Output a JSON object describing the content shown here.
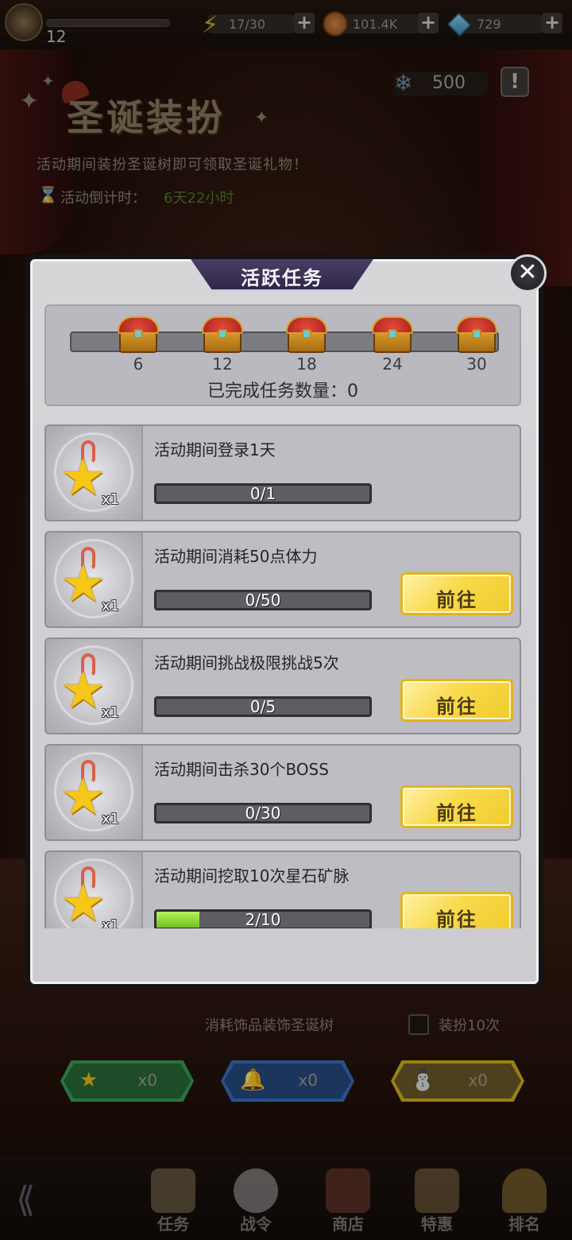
{
  "topbar": {
    "level": "12",
    "stamina": "17/30",
    "gold": "101.4K",
    "gems": "729"
  },
  "event": {
    "title": "圣诞装扮",
    "description": "活动期间装扮圣诞树即可领取圣诞礼物！",
    "countdown_label": "活动倒计时：",
    "countdown_value": "6天22小时",
    "snowflakes": "500"
  },
  "modal": {
    "title": "活跃任务",
    "milestones": [
      "6",
      "12",
      "18",
      "24",
      "30"
    ],
    "completed_label": "已完成任务数量：0",
    "go_label": "前往",
    "tasks": [
      {
        "title": "活动期间登录1天",
        "progress": "0/1",
        "reward": "x1",
        "fraction": 0,
        "has_button": false
      },
      {
        "title": "活动期间消耗50点体力",
        "progress": "0/50",
        "reward": "x1",
        "fraction": 0,
        "has_button": true
      },
      {
        "title": "活动期间挑战极限挑战5次",
        "progress": "0/5",
        "reward": "x1",
        "fraction": 0,
        "has_button": true
      },
      {
        "title": "活动期间击杀30个BOSS",
        "progress": "0/30",
        "reward": "x1",
        "fraction": 0,
        "has_button": true
      },
      {
        "title": "活动期间挖取10次星石矿脉",
        "progress": "2/10",
        "reward": "x1",
        "fraction": 0.2,
        "has_button": true
      }
    ]
  },
  "decorate": {
    "label": "消耗饰品装饰圣诞树",
    "checkbox_label": "装扮10次",
    "ornaments": [
      {
        "icon": "star-ornament-icon",
        "count": "x0",
        "color": "#2d8a4a"
      },
      {
        "icon": "bell-ornament-icon",
        "count": "x0",
        "color": "#2f5fa8"
      },
      {
        "icon": "snowman-ornament-icon",
        "count": "x0",
        "color": "#c9a020"
      }
    ]
  },
  "nav": {
    "items": [
      "任务",
      "战令",
      "商店",
      "特惠",
      "排名"
    ]
  }
}
